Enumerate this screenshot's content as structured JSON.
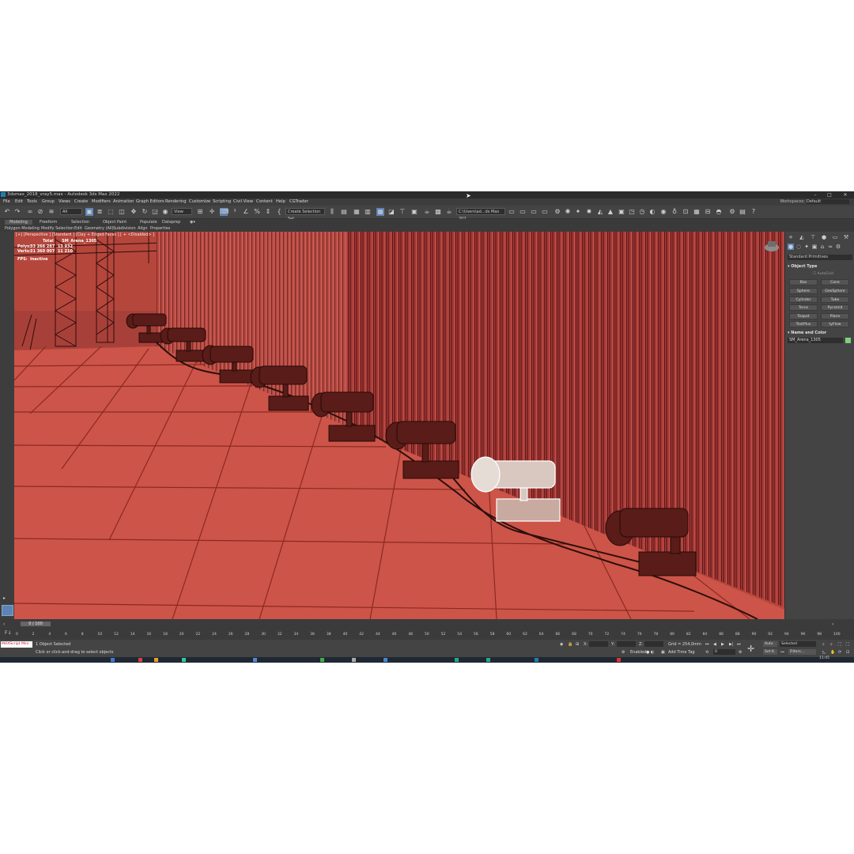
{
  "window": {
    "title": "3dsmax_2018_vray5.max - Autodesk 3ds Max 2022",
    "controls": [
      "–",
      "□",
      "✕"
    ]
  },
  "menu": {
    "items": [
      "File",
      "Edit",
      "Tools",
      "Group",
      "Views",
      "Create",
      "Modifiers",
      "Animation",
      "Graph Editors",
      "Rendering",
      "Customize",
      "Scripting",
      "Civil View",
      "Content",
      "Help",
      "CGTrader"
    ],
    "workspaces_label": "Workspaces:",
    "workspaces_value": "Default"
  },
  "toolbar": {
    "selection_filter": "All",
    "reference_coord": "View",
    "named_selection": "Create Selection Set",
    "path": "C:\\Users\\ad...ds Max 202"
  },
  "ribbon": {
    "tabs": [
      "Modeling",
      "Freeform",
      "Selection",
      "Object Paint",
      "Populate",
      "Dataprep"
    ],
    "subtabs": [
      "Polygon Modeling",
      "Modify Selection",
      "Edit",
      "Geometry (All)",
      "Subdivision",
      "Align",
      "Properties"
    ]
  },
  "viewport": {
    "label": "[+] [Perspective ] [Standard ] [Clay + Edged Faces ] [ + <Disabled> ]",
    "stats": {
      "header_total": "Total",
      "header_object": "SM_Arena_1305",
      "polys_label": "Polys:",
      "polys_total": "33 266 287",
      "polys_object": "13 932",
      "verts_label": "Verts:",
      "verts_total": "31 360 007",
      "verts_object": "11 210",
      "fps_label": "FPS:",
      "fps_value": "Inactive"
    },
    "colors": {
      "floor": "#cd5448",
      "curtain": "#9c2f2f",
      "wire": "#3a1410",
      "selected": "#ffffff"
    }
  },
  "command_panel": {
    "category": "Standard Primitives",
    "object_type_title": "Object Type",
    "autogrid": "AutoGrid",
    "primitives": [
      "Box",
      "Cone",
      "Sphere",
      "GeoSphere",
      "Cylinder",
      "Tube",
      "Torus",
      "Pyramid",
      "Teapot",
      "Plane",
      "TextPlus",
      "tyFlow"
    ],
    "name_color_title": "Name and Color",
    "object_name": "SM_Arena_1305",
    "object_color": "#7ed07e"
  },
  "timeline": {
    "slider": "0 / 100",
    "ticks": [
      "0",
      "2",
      "4",
      "6",
      "8",
      "10",
      "12",
      "14",
      "16",
      "18",
      "20",
      "22",
      "24",
      "26",
      "28",
      "30",
      "32",
      "34",
      "36",
      "38",
      "40",
      "42",
      "44",
      "46",
      "48",
      "50",
      "52",
      "54",
      "56",
      "58",
      "60",
      "62",
      "64",
      "66",
      "68",
      "70",
      "72",
      "74",
      "76",
      "78",
      "80",
      "82",
      "84",
      "86",
      "88",
      "90",
      "92",
      "94",
      "96",
      "98",
      "100"
    ]
  },
  "status": {
    "maxscript": "MAXScript Mini",
    "selected": "1 Object Selected",
    "prompt": "Click or click-and-drag to select objects",
    "x_label": "X:",
    "y_label": "Y:",
    "z_label": "Z:",
    "grid": "Grid = 254,0mm",
    "enabled": "Enabled:",
    "add_time_tag": "Add Time Tag",
    "auto": "Auto",
    "set_k": "Set K.",
    "selected_dropdown": "Selected",
    "filters": "Filters...",
    "frame": "0"
  },
  "taskbar": {
    "time": "11:45"
  }
}
